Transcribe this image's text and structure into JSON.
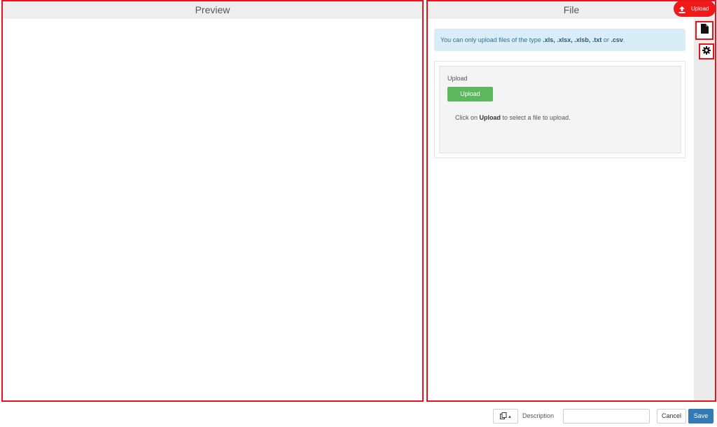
{
  "preview": {
    "title": "Preview"
  },
  "file_panel": {
    "title": "File",
    "info": {
      "prefix": "You can only upload files of the type ",
      "types": ".xls, .xlsx, .xlsb, .txt",
      "or": " or ",
      "last": ".csv",
      "suffix": "."
    },
    "upload_section": {
      "label": "Upload",
      "button_label": "Upload",
      "hint_prefix": "Click on ",
      "hint_bold": "Upload",
      "hint_suffix": " to select a file to upload."
    }
  },
  "header_upload": {
    "label": "Upload",
    "icon": "upload-icon"
  },
  "side_buttons": [
    {
      "icon": "file-icon"
    },
    {
      "icon": "gear-icon"
    }
  ],
  "footer": {
    "copy_icon": "copy-icon",
    "description_label": "Description",
    "description_value": "",
    "cancel_label": "Cancel",
    "save_label": "Save"
  },
  "colors": {
    "highlight_border": "#e8121a",
    "upload_green": "#5cb85c",
    "save_blue": "#337ab7",
    "info_bg": "#d9edf7"
  }
}
